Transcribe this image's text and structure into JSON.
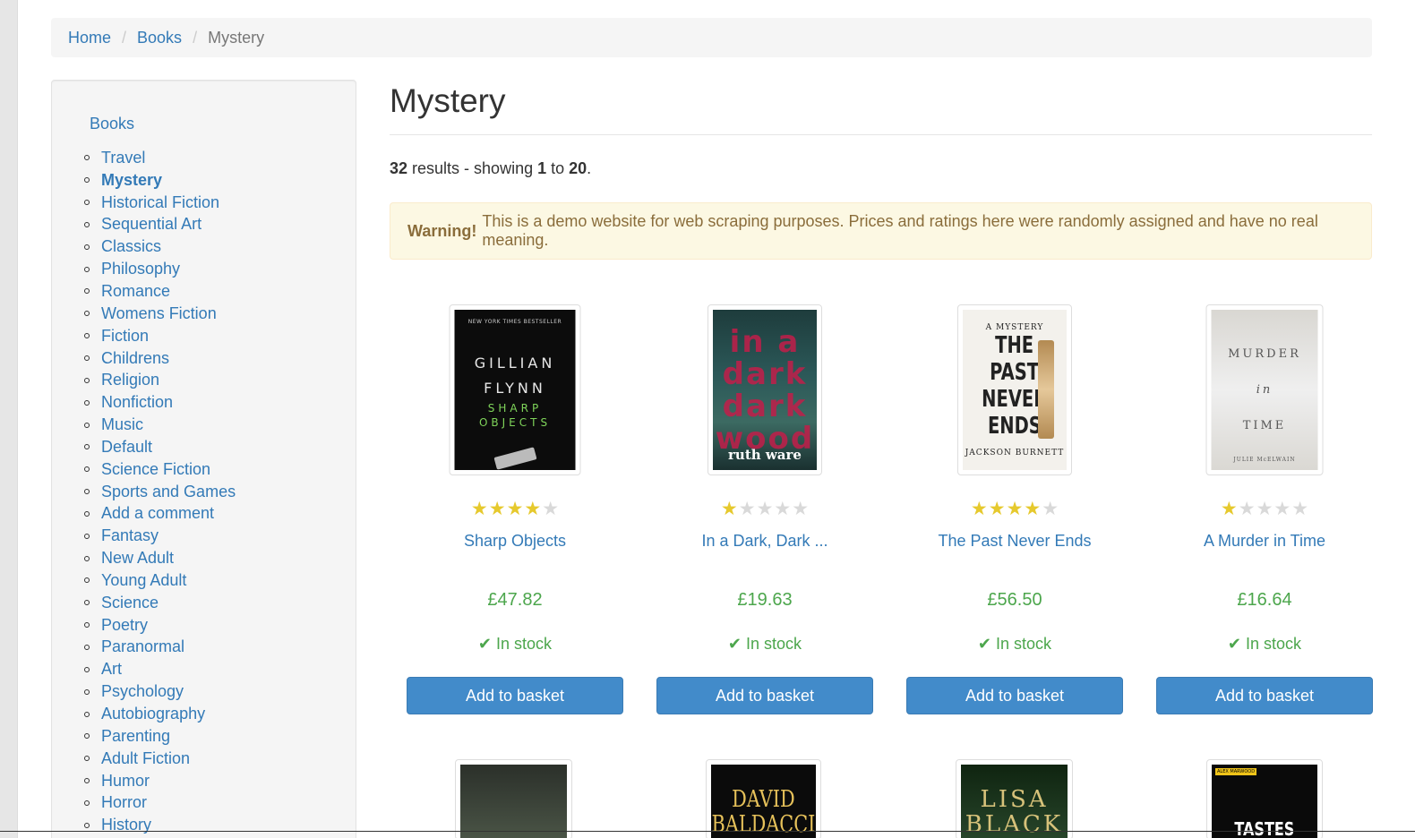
{
  "breadcrumb": {
    "items": [
      "Home",
      "Books"
    ],
    "separator": "/",
    "current": "Mystery"
  },
  "sidebar": {
    "root": "Books",
    "categories": [
      "Travel",
      "Mystery",
      "Historical Fiction",
      "Sequential Art",
      "Classics",
      "Philosophy",
      "Romance",
      "Womens Fiction",
      "Fiction",
      "Childrens",
      "Religion",
      "Nonfiction",
      "Music",
      "Default",
      "Science Fiction",
      "Sports and Games",
      "Add a comment",
      "Fantasy",
      "New Adult",
      "Young Adult",
      "Science",
      "Poetry",
      "Paranormal",
      "Art",
      "Psychology",
      "Autobiography",
      "Parenting",
      "Adult Fiction",
      "Humor",
      "Horror",
      "History"
    ],
    "current": "Mystery"
  },
  "page": {
    "title": "Mystery",
    "results_count": "32",
    "results_text_1": " results - showing ",
    "results_from": "1",
    "results_to_word": " to ",
    "results_to": "20",
    "results_end": "."
  },
  "alert": {
    "strong": "Warning!",
    "text": "This is a demo website for web scraping purposes. Prices and ratings here were randomly assigned and have no real meaning."
  },
  "products": [
    {
      "title": "Sharp Objects",
      "rating": 4,
      "price": "£47.82",
      "stock": "In stock",
      "button": "Add to basket",
      "cover": {
        "top": "NEW YORK TIMES BESTSELLER",
        "line1": "GILLIAN",
        "line2": "FLYNN",
        "line3": "SHARP",
        "line4": "OBJECTS"
      }
    },
    {
      "title": "In a Dark, Dark ...",
      "rating": 1,
      "price": "£19.63",
      "stock": "In stock",
      "button": "Add to basket",
      "cover": {
        "line1": "in a",
        "line2": "dark",
        "line3": "dark",
        "line4": "wood",
        "author": "ruth ware"
      }
    },
    {
      "title": "The Past Never Ends",
      "rating": 4,
      "price": "£56.50",
      "stock": "In stock",
      "button": "Add to basket",
      "cover": {
        "top": "A MYSTERY",
        "line1": "THE",
        "line2": "PAST",
        "line3": "NEVER",
        "line4": "ENDS",
        "author": "JACKSON BURNETT"
      }
    },
    {
      "title": "A Murder in Time",
      "rating": 1,
      "price": "£16.64",
      "stock": "In stock",
      "button": "Add to basket",
      "cover": {
        "line1": "MURDER",
        "line2": "in",
        "line3": "TIME",
        "author": "JULIE McELWAIN"
      }
    }
  ],
  "next_row_covers": [
    {
      "text": ""
    },
    {
      "text": "DAVID BALDACCI"
    },
    {
      "text": "LISA BLACK"
    },
    {
      "text": "TASTES",
      "tag": "ALEX MARWOOD"
    }
  ],
  "colors": {
    "link": "#337ab7",
    "price": "#4ca64c",
    "star_on": "#e6c92d",
    "star_off": "#d9d9d9",
    "button": "#428bca",
    "alert_bg": "#fcf8e3",
    "alert_text": "#8a6d3b"
  }
}
